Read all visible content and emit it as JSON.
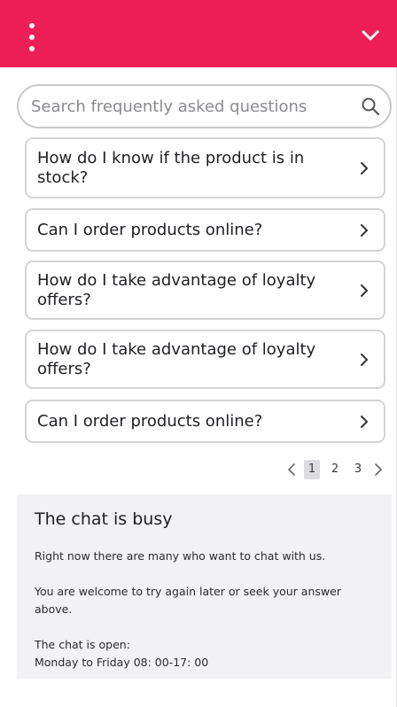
{
  "header": {
    "menu_icon": "more-vertical-icon",
    "collapse_icon": "chevron-down-icon",
    "background_color": "#ee1f57"
  },
  "search": {
    "placeholder": "Search frequently asked questions",
    "value": "",
    "icon": "search-icon"
  },
  "faq": [
    {
      "question": "How do I know if the product is in stock?"
    },
    {
      "question": "Can I order products online?"
    },
    {
      "question": "How do I take advantage of loyalty offers?"
    },
    {
      "question": "How do I take advantage of loyalty offers?"
    },
    {
      "question": "Can I order products online?"
    }
  ],
  "pagination": {
    "pages": [
      "1",
      "2",
      "3"
    ],
    "current": "1"
  },
  "chat_status": {
    "title": "The chat is busy",
    "message": "Right now there are many who want to chat with us.",
    "advice": "You are welcome to try again later or seek your answer above.",
    "hours_label": "The chat is open:",
    "hours": "Monday to Friday 08: 00-17: 00"
  }
}
